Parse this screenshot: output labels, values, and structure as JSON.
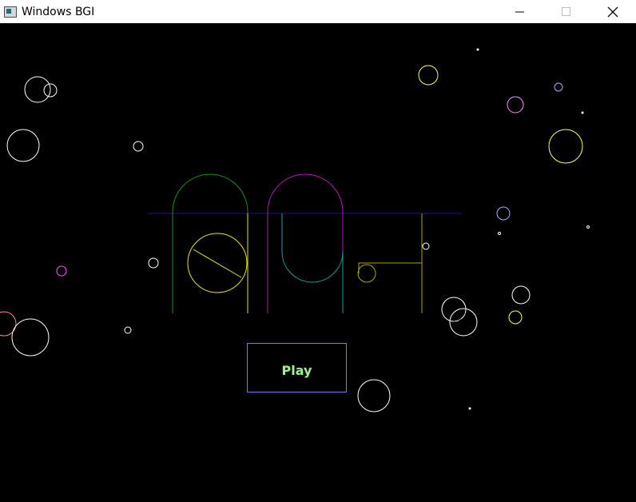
{
  "window": {
    "title": "Windows BGI",
    "controls": [
      "minimize",
      "maximize",
      "close"
    ]
  },
  "logo": {
    "colors": {
      "first_arch": "#1b8a1b",
      "ball": "#e6e600",
      "second_arch": "#b01bb0",
      "inner_loop": "#1ba0a0",
      "hook": "#a8a800",
      "baseline": "#1a1a8c"
    }
  },
  "play_button": {
    "label": "Play",
    "border_color": "#7b7bf0",
    "text_color": "#9cf48a"
  },
  "background": {
    "color": "#000000",
    "bubble_colors": [
      "#ffffff",
      "#ffff55",
      "#ff55ff",
      "#55ff55",
      "#ff5555",
      "#aaaaff",
      "#b00000",
      "#00a000"
    ]
  }
}
